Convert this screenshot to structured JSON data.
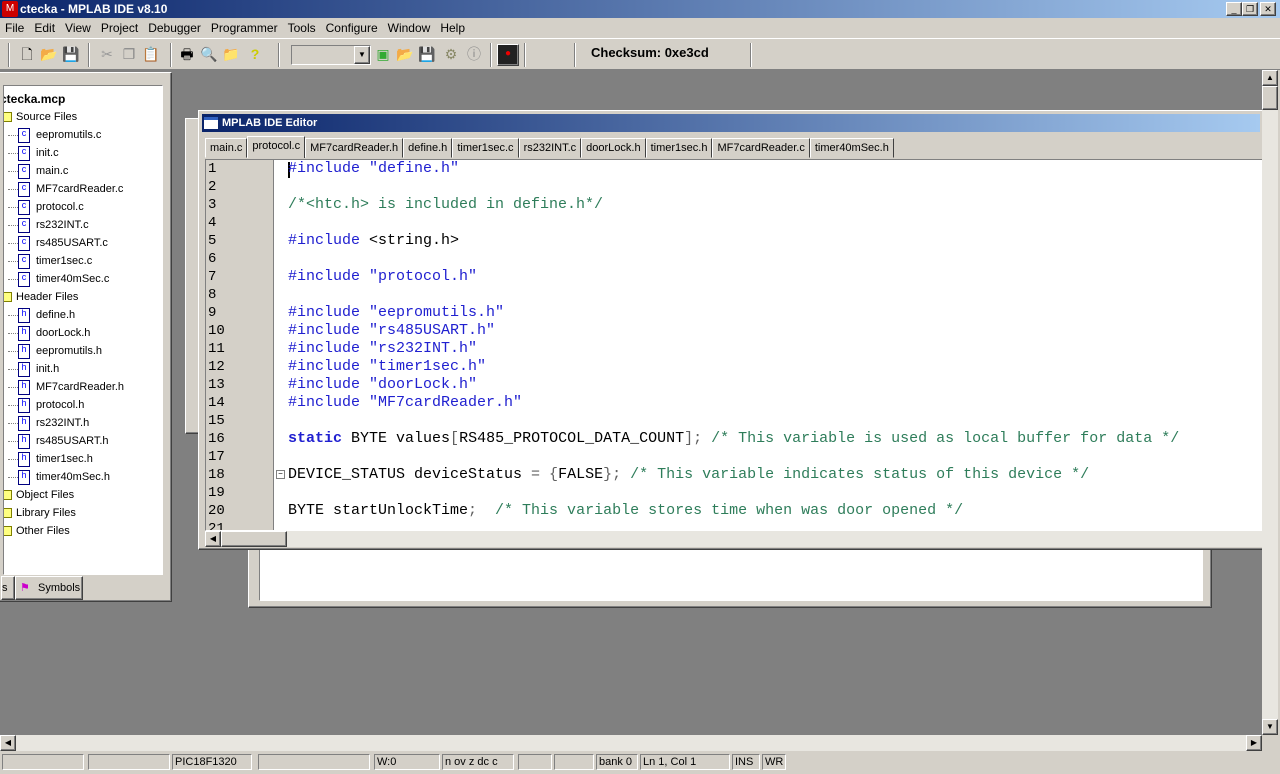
{
  "app": {
    "title": "ctecka - MPLAB IDE v8.10",
    "icon": "mplab-logo-icon"
  },
  "menu": [
    "File",
    "Edit",
    "View",
    "Project",
    "Debugger",
    "Programmer",
    "Tools",
    "Configure",
    "Window",
    "Help"
  ],
  "toolbar": {
    "checksum": "Checksum: 0xe3cd",
    "config_select": ""
  },
  "project": {
    "name": "ctecka.mcp",
    "groups": [
      {
        "label": "Source Files",
        "files": [
          "eepromutils.c",
          "init.c",
          "main.c",
          "MF7cardReader.c",
          "protocol.c",
          "rs232INT.c",
          "rs485USART.c",
          "timer1sec.c",
          "timer40mSec.c"
        ]
      },
      {
        "label": "Header Files",
        "files": [
          "define.h",
          "doorLock.h",
          "eepromutils.h",
          "init.h",
          "MF7cardReader.h",
          "protocol.h",
          "rs232INT.h",
          "rs485USART.h",
          "timer1sec.h",
          "timer40mSec.h"
        ]
      },
      {
        "label": "Object Files",
        "files": []
      },
      {
        "label": "Library Files",
        "files": []
      },
      {
        "label": "Other Files",
        "files": []
      }
    ],
    "tabs": {
      "files_partial": "s",
      "symbols": "Symbols"
    }
  },
  "editor": {
    "title": "MPLAB IDE Editor",
    "active_tab": 1,
    "tabs": [
      "main.c",
      "protocol.c",
      "MF7cardReader.h",
      "define.h",
      "timer1sec.c",
      "rs232INT.c",
      "doorLock.h",
      "timer1sec.h",
      "MF7cardReader.c",
      "timer40mSec.h"
    ],
    "lines": [
      [
        [
          "#include \"define.h\"",
          "kw"
        ]
      ],
      [],
      [
        [
          "/*<htc.h> is included in define.h*/",
          "cm"
        ]
      ],
      [],
      [
        [
          "#include ",
          "kw"
        ],
        [
          "<string.h>",
          "pl"
        ]
      ],
      [],
      [
        [
          "#include \"protocol.h\"",
          "kw"
        ]
      ],
      [],
      [
        [
          "#include \"eepromutils.h\"",
          "kw"
        ]
      ],
      [
        [
          "#include \"rs485USART.h\"",
          "kw"
        ]
      ],
      [
        [
          "#include \"rs232INT.h\"",
          "kw"
        ]
      ],
      [
        [
          "#include \"timer1sec.h\"",
          "kw"
        ]
      ],
      [
        [
          "#include \"doorLock.h\"",
          "kw"
        ]
      ],
      [
        [
          "#include \"MF7cardReader.h\"",
          "kw"
        ]
      ],
      [],
      [
        [
          "static",
          "kwb"
        ],
        [
          " BYTE values",
          "pl"
        ],
        [
          "[",
          "op"
        ],
        [
          "RS485_PROTOCOL_DATA_COUNT",
          "pl"
        ],
        [
          "];",
          "op"
        ],
        [
          " /* This variable is used as local buffer for data */",
          "cm"
        ]
      ],
      [],
      [
        [
          "DEVICE_STATUS deviceStatus ",
          "pl"
        ],
        [
          "= {",
          "op"
        ],
        [
          "FALSE",
          "pl"
        ],
        [
          "};",
          "op"
        ],
        [
          " /* This variable indicates status of this device */",
          "cm"
        ]
      ],
      [],
      [
        [
          "BYTE startUnlockTime",
          "pl"
        ],
        [
          ";",
          "op"
        ],
        [
          "  /* This variable stores time when was door opened */",
          "cm"
        ]
      ],
      []
    ]
  },
  "status": [
    "",
    "",
    "PIC18F1320",
    "",
    "W:0",
    "n ov z dc c",
    "",
    "",
    "bank 0",
    "Ln 1, Col 1",
    "INS",
    "WR"
  ]
}
